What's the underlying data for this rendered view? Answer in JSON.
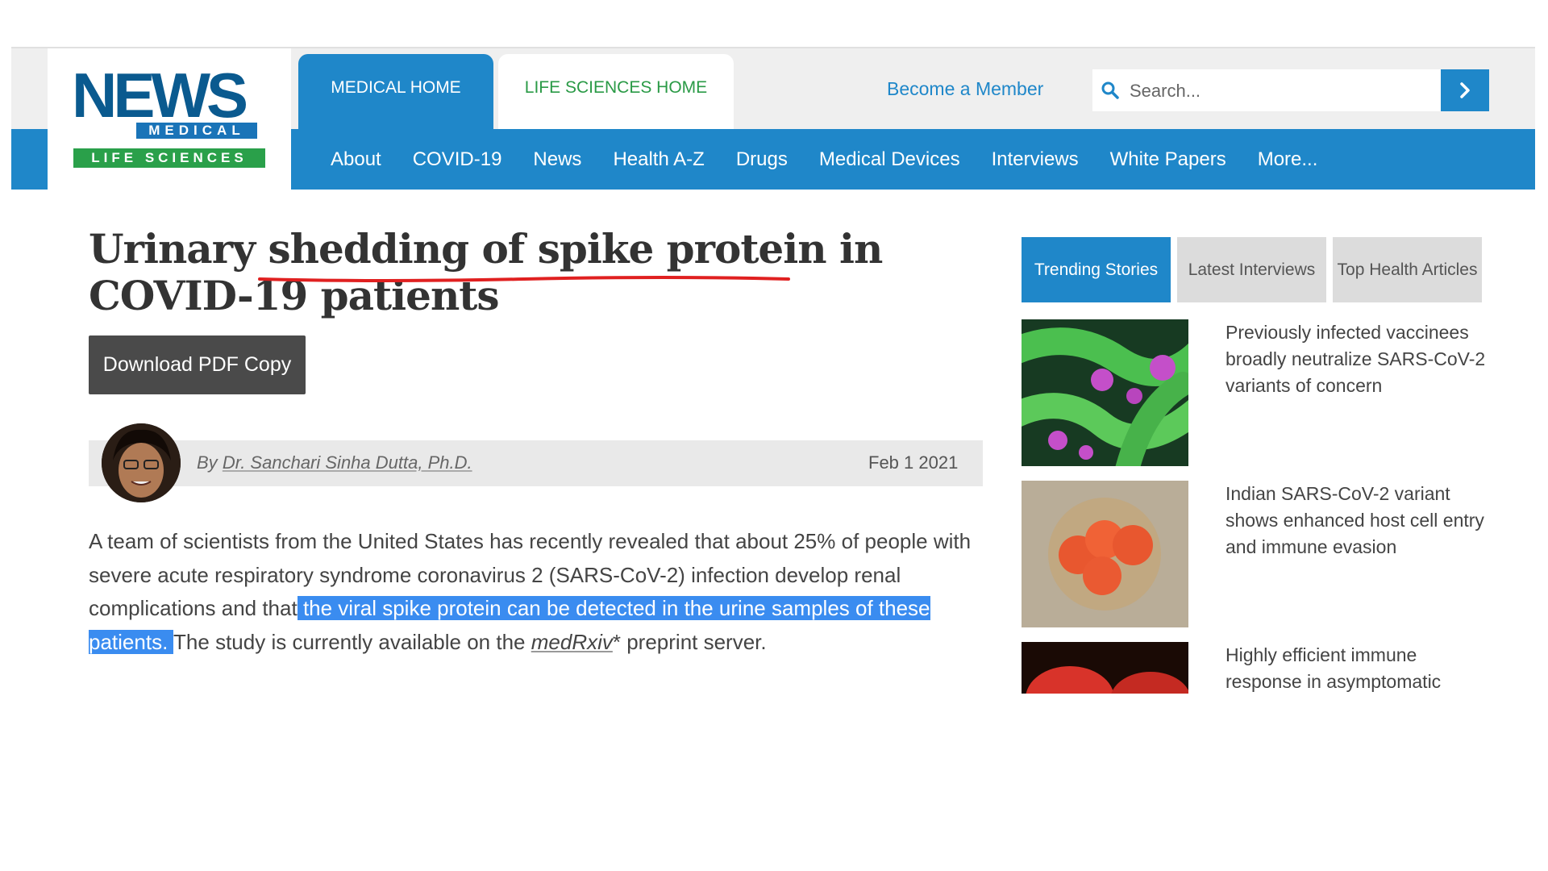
{
  "logo": {
    "news": "NEWS",
    "medical": "MEDICAL",
    "life_sciences": "LIFE SCIENCES"
  },
  "tabs": {
    "medical_home": "MEDICAL HOME",
    "life_sciences_home": "LIFE SCIENCES HOME"
  },
  "header": {
    "member_link": "Become a Member",
    "search_placeholder": "Search...",
    "search_button_icon": "chevron-right-icon"
  },
  "nav": {
    "items": [
      "About",
      "COVID-19",
      "News",
      "Health A-Z",
      "Drugs",
      "Medical Devices",
      "Interviews",
      "White Papers",
      "More..."
    ]
  },
  "article": {
    "title": "Urinary shedding of spike protein in COVID-19 patients",
    "pdf_button": "Download PDF Copy",
    "byline_prefix": "By",
    "author": "Dr. Sanchari Sinha Dutta, Ph.D.",
    "date": "Feb 1 2021",
    "body_before": "A team of scientists from the United States has recently revealed that about 25% of people with severe acute respiratory syndrome coronavirus 2 (SARS-CoV-2) infection develop renal complications and that",
    "body_highlight": " the viral spike protein can be detected in the urine samples of these patients. ",
    "body_mid": "The study is currently available on the ",
    "source": "medRxiv",
    "body_after": "* preprint server."
  },
  "sidebar": {
    "tabs": [
      "Trending Stories",
      "Latest Interviews",
      "Top Health Articles"
    ],
    "stories": [
      "Previously infected vaccinees broadly neutralize SARS-CoV-2 variants of concern",
      "Indian SARS-CoV-2 variant shows enhanced host cell entry and immune evasion",
      "Highly efficient immune response in asymptomatic"
    ]
  },
  "colors": {
    "brand_blue": "#1f87c9",
    "brand_green": "#2a9a46",
    "highlight": "#3a8cf0",
    "spellcheck_underline": "#e02020"
  }
}
